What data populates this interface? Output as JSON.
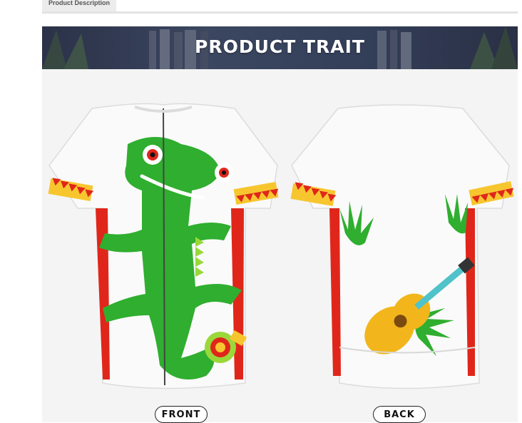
{
  "tabs": {
    "active_label": "Product Description"
  },
  "banner": {
    "title": "PRODUCT TRAIT"
  },
  "views": {
    "front_label": "FRONT",
    "back_label": "BACK"
  },
  "colors": {
    "lizard_green": "#2fae2f",
    "accent_red": "#e0261b",
    "guitar_yellow": "#f2b61c",
    "banner_navy": "#2e3650"
  }
}
